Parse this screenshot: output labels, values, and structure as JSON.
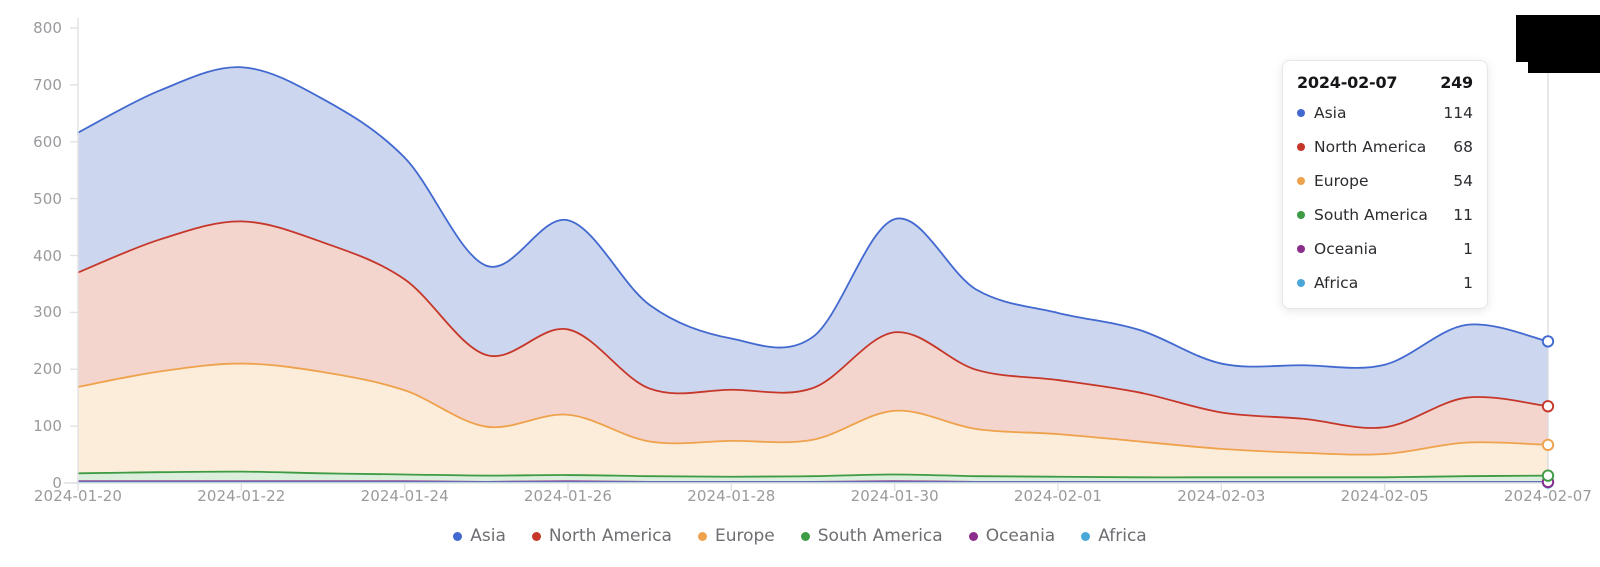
{
  "chart_data": {
    "type": "area",
    "stacked": true,
    "title": "",
    "xlabel": "",
    "ylabel": "",
    "ylim": [
      0,
      800
    ],
    "y_ticks": [
      0,
      100,
      200,
      300,
      400,
      500,
      600,
      700,
      800
    ],
    "grid": false,
    "legend_position": "bottom",
    "x": [
      "2024-01-20",
      "2024-01-21",
      "2024-01-22",
      "2024-01-23",
      "2024-01-24",
      "2024-01-25",
      "2024-01-26",
      "2024-01-27",
      "2024-01-28",
      "2024-01-29",
      "2024-01-30",
      "2024-01-31",
      "2024-02-01",
      "2024-02-02",
      "2024-02-03",
      "2024-02-04",
      "2024-02-05",
      "2024-02-06",
      "2024-02-07"
    ],
    "x_tick_labels": [
      "2024-01-20",
      "2024-01-22",
      "2024-01-24",
      "2024-01-26",
      "2024-01-28",
      "2024-01-30",
      "2024-02-01",
      "2024-02-03",
      "2024-02-05",
      "2024-02-07"
    ],
    "series": [
      {
        "name": "Asia",
        "color": "#4269d0",
        "fill": "#ccd6ee",
        "values": [
          246,
          262,
          271,
          252,
          214,
          157,
          192,
          147,
          90,
          90,
          199,
          141,
          118,
          110,
          86,
          94,
          110,
          128,
          114
        ]
      },
      {
        "name": "North America",
        "color": "#c6372a",
        "fill": "#f3d5cd",
        "values": [
          201,
          232,
          250,
          228,
          195,
          126,
          150,
          93,
          90,
          91,
          138,
          104,
          95,
          86,
          64,
          60,
          47,
          79,
          68
        ]
      },
      {
        "name": "Europe",
        "color": "#efa24c",
        "fill": "#fceddb",
        "values": [
          152,
          177,
          190,
          178,
          148,
          86,
          106,
          61,
          63,
          64,
          112,
          83,
          75,
          63,
          50,
          43,
          41,
          59,
          54
        ]
      },
      {
        "name": "South America",
        "color": "#3c9b43",
        "fill": "#dcefdc",
        "values": [
          14,
          16,
          17,
          14,
          12,
          11,
          11,
          10,
          9,
          10,
          12,
          10,
          9,
          8,
          8,
          8,
          8,
          10,
          11
        ]
      },
      {
        "name": "Oceania",
        "color": "#8b2d8b",
        "fill": "#eadcea",
        "values": [
          2,
          2,
          2,
          2,
          2,
          1,
          2,
          1,
          1,
          1,
          2,
          1,
          1,
          1,
          1,
          1,
          1,
          1,
          1
        ]
      },
      {
        "name": "Africa",
        "color": "#4aa8d8",
        "fill": "#d8ecf6",
        "values": [
          1,
          1,
          1,
          1,
          1,
          1,
          1,
          1,
          1,
          1,
          1,
          1,
          1,
          1,
          1,
          1,
          1,
          1,
          1
        ]
      }
    ]
  },
  "tooltip": {
    "date": "2024-02-07",
    "total": "249",
    "rows": [
      {
        "name": "Asia",
        "value": "114",
        "color": "#4269d0"
      },
      {
        "name": "North America",
        "value": "68",
        "color": "#c6372a"
      },
      {
        "name": "Europe",
        "value": "54",
        "color": "#efa24c"
      },
      {
        "name": "South America",
        "value": "11",
        "color": "#3c9b43"
      },
      {
        "name": "Oceania",
        "value": "1",
        "color": "#8b2d8b"
      },
      {
        "name": "Africa",
        "value": "1",
        "color": "#4aa8d8"
      }
    ]
  },
  "legend": {
    "items": [
      {
        "label": "Asia",
        "color": "#4269d0"
      },
      {
        "label": "North America",
        "color": "#c6372a"
      },
      {
        "label": "Europe",
        "color": "#efa24c"
      },
      {
        "label": "South America",
        "color": "#3c9b43"
      },
      {
        "label": "Oceania",
        "color": "#8b2d8b"
      },
      {
        "label": "Africa",
        "color": "#4aa8d8"
      }
    ]
  },
  "axes": {
    "axis_color": "#e2e2e4",
    "tick_text_color": "#9a9a9e"
  },
  "overlay": {
    "note": "black-redaction-block"
  }
}
